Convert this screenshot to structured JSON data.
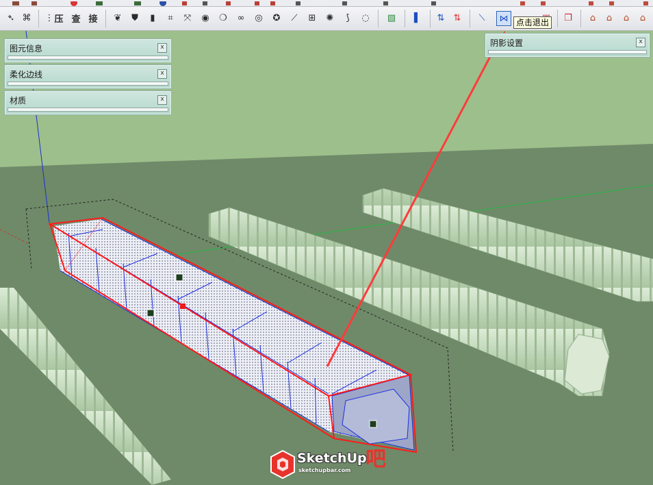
{
  "toolbar": {
    "top_icons": [
      "paint-icon",
      "pencil-icon",
      "camera-icon",
      "cube-icon",
      "arrow-icon",
      "globe-icon",
      "shapes-icon"
    ],
    "left_group_icons": [
      "leaf-icon",
      "shield-icon",
      "cylinder-icon",
      "connect-icon",
      "split-icon",
      "target-icon",
      "drop-icon",
      "link-icon",
      "ring-icon",
      "slash-icon",
      "grid-icon",
      "gear-icon",
      "curve-icon",
      "spiral-icon"
    ],
    "cn_buttons": [
      "压",
      "查",
      "接"
    ],
    "tooltip": "点击退出",
    "right_group_icons": [
      "box-icon",
      "column-icon",
      "flip-vertical-icon",
      "flip-red-icon",
      "draw-line-icon",
      "exit-icon",
      "box-red-icon",
      "paste-icon",
      "house-1-icon",
      "house-2-icon",
      "house-3-icon",
      "house-4-icon"
    ]
  },
  "panels": {
    "entity_info": "图元信息",
    "soften_edges": "柔化边线",
    "materials": "材质",
    "shadow_settings": "阴影设置",
    "close_glyph": "x"
  },
  "logo": {
    "brand": "SketchUp",
    "ba": "吧",
    "url": "sketchupbar.com"
  },
  "colors": {
    "sky": "#9dbf8b",
    "ground": "#6f8a68",
    "selection": "#ff1a1a",
    "edges_selected": "#1a2ee0",
    "tunnel_green": "#c7dfc0",
    "arrow": "#ff3b3b"
  }
}
